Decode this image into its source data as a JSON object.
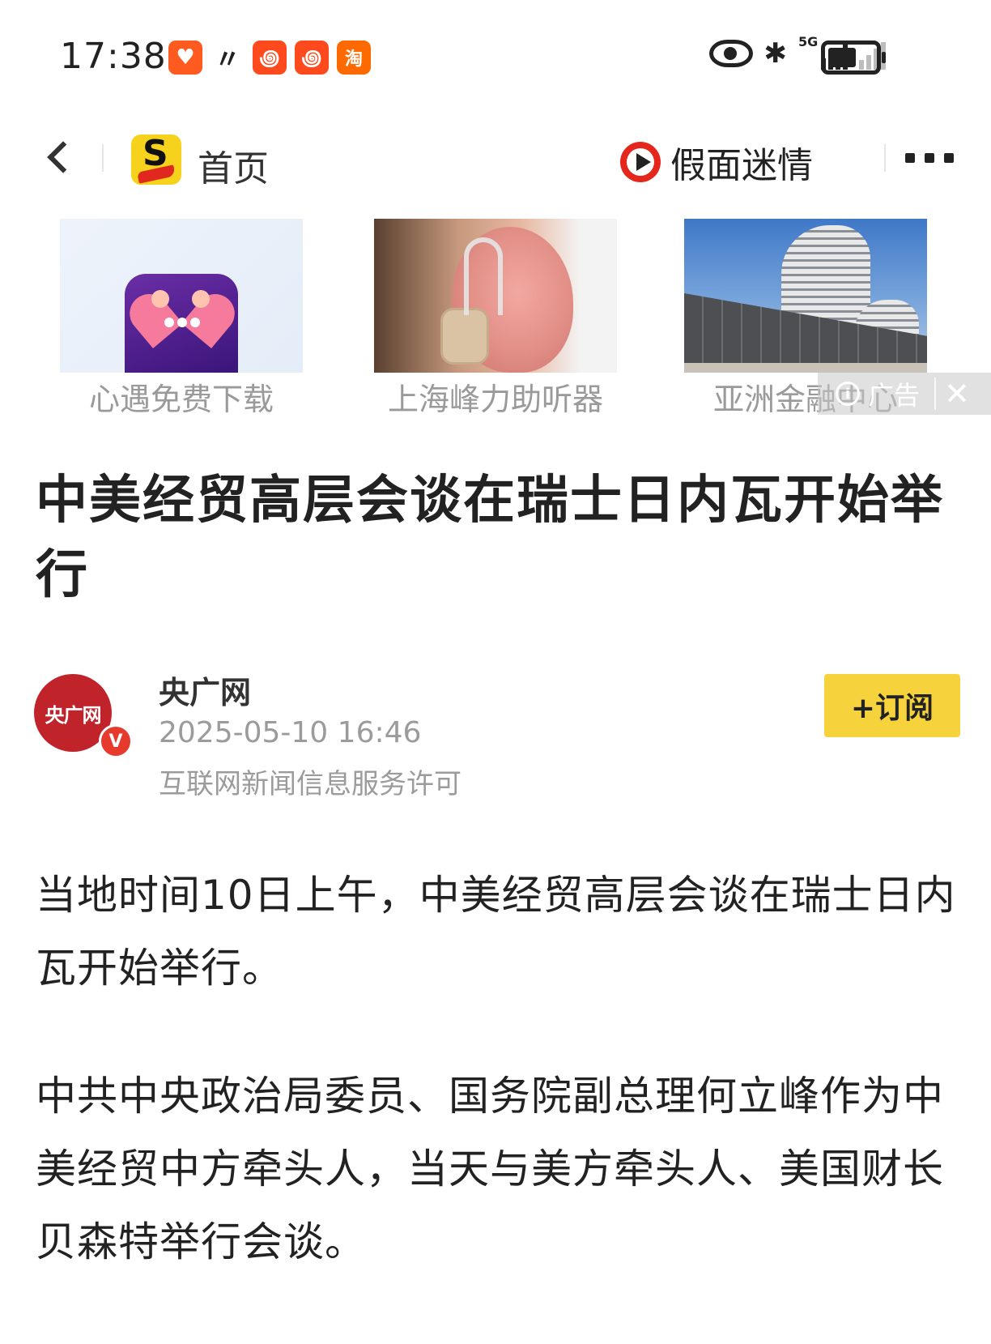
{
  "status_bar": {
    "time": "17:38",
    "apps": [
      {
        "name": "taobao-heart",
        "glyph": "♥"
      },
      {
        "name": "vee",
        "glyph": "〃"
      },
      {
        "name": "kuaishou-1",
        "glyph": "꩜"
      },
      {
        "name": "kuaishou-2",
        "glyph": "꩜"
      },
      {
        "name": "taobao",
        "glyph": "淘"
      }
    ],
    "network_label": "5G"
  },
  "nav": {
    "home_label": "首页",
    "channel_name": "假面迷情"
  },
  "ads": {
    "items": [
      {
        "label": "心遇免费下载"
      },
      {
        "label": "上海峰力助听器"
      },
      {
        "label": "亚洲金融中心"
      }
    ],
    "tag_text": "广告",
    "close_glyph": "✕"
  },
  "article": {
    "title": "中美经贸高层会谈在瑞士日内瓦开始举行",
    "source": {
      "avatar_text": "央广网",
      "name": "央广网",
      "verified_glyph": "V",
      "time": "2025-05-10 16:46",
      "license": "互联网新闻信息服务许可"
    },
    "subscribe_label": "+订阅",
    "paragraphs": [
      "当地时间10日上午，中美经贸高层会谈在瑞士日内瓦开始举行。",
      "中共中央政治局委员、国务院副总理何立峰作为中美经贸中方牵头人，当天与美方牵头人、美国财长贝森特举行会谈。"
    ]
  },
  "colors": {
    "accent_yellow": "#f6d33c",
    "brand_red": "#c0242a",
    "muted_text": "#9b9b9b"
  }
}
